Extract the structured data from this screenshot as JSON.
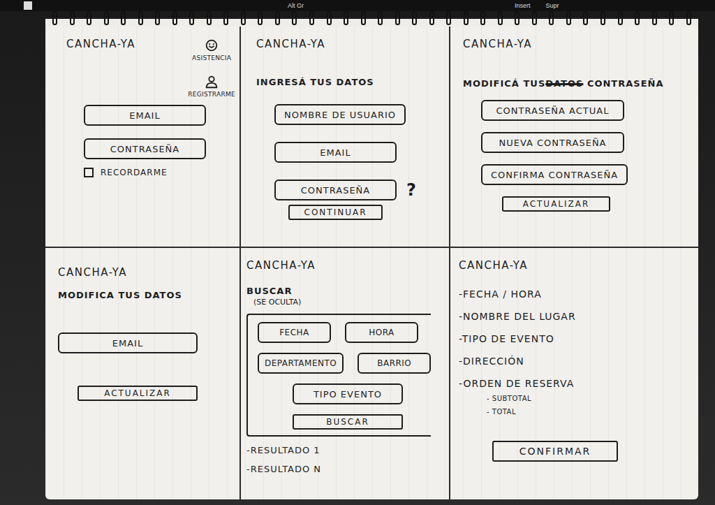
{
  "keyboard": [
    "Alt Gr",
    "Insert",
    "Supr"
  ],
  "screens": [
    {
      "title": "CANCHA-YA",
      "actions": [
        "ASISTENCIA",
        "REGISTRARME"
      ],
      "items": [
        {
          "kind": "field",
          "label": "EMAIL"
        },
        {
          "kind": "field",
          "label": "CONTRASEÑA"
        },
        {
          "kind": "checkbox",
          "label": "RECORDARME",
          "checked": false
        }
      ]
    },
    {
      "title": "CANCHA-YA",
      "items": [
        {
          "kind": "heading",
          "text": "INGRESÁ TUS DATOS"
        },
        {
          "kind": "field",
          "label": "NOMBRE DE USUARIO"
        },
        {
          "kind": "field",
          "label": "EMAIL"
        },
        {
          "kind": "field",
          "label": "CONTRASEÑA",
          "hint": "?"
        },
        {
          "kind": "button",
          "label": "CONTINUAR"
        }
      ]
    },
    {
      "title": "CANCHA-YA",
      "items": [
        {
          "kind": "heading",
          "text": "MODIFICÁ TUS",
          "struck": "DATOS",
          "after": "CONTRASEÑA"
        },
        {
          "kind": "field",
          "label": "CONTRASEÑA ACTUAL"
        },
        {
          "kind": "field",
          "label": "NUEVA CONTRASEÑA"
        },
        {
          "kind": "field",
          "label": "CONFIRMA CONTRASEÑA"
        },
        {
          "kind": "button",
          "label": "ACTUALIZAR"
        }
      ]
    },
    {
      "title": "CANCHA-YA",
      "items": [
        {
          "kind": "heading",
          "text": "MODIFICA TUS DATOS"
        },
        {
          "kind": "field",
          "label": "EMAIL"
        },
        {
          "kind": "button",
          "label": "ACTUALIZAR"
        }
      ]
    },
    {
      "title": "CANCHA-YA",
      "items": [
        {
          "kind": "heading",
          "text": "BUSCAR"
        },
        {
          "kind": "note",
          "text": "(SE OCULTA)"
        },
        {
          "kind": "group",
          "items": [
            {
              "kind": "row",
              "items": [
                {
                  "kind": "field",
                  "label": "FECHA"
                },
                {
                  "kind": "field",
                  "label": "HORA"
                }
              ]
            },
            {
              "kind": "row",
              "items": [
                {
                  "kind": "field",
                  "label": "DEPARTAMENTO"
                },
                {
                  "kind": "field",
                  "label": "BARRIO"
                }
              ]
            },
            {
              "kind": "field",
              "label": "TIPO EVENTO"
            },
            {
              "kind": "button",
              "label": "BUSCAR"
            }
          ]
        },
        {
          "kind": "list",
          "text": "-RESULTADO 1"
        },
        {
          "kind": "list",
          "text": "-RESULTADO N"
        }
      ]
    },
    {
      "title": "CANCHA-YA",
      "items": [
        {
          "kind": "list",
          "text": "-FECHA / HORA"
        },
        {
          "kind": "list",
          "text": "-NOMBRE DEL LUGAR"
        },
        {
          "kind": "list",
          "text": "-TIPO DE EVENTO"
        },
        {
          "kind": "list",
          "text": "-DIRECCIÓN"
        },
        {
          "kind": "list",
          "text": "-ORDEN DE RESERVA"
        },
        {
          "kind": "sub",
          "text": "- SUBTOTAL"
        },
        {
          "kind": "sub",
          "text": "- TOTAL"
        },
        {
          "kind": "button",
          "label": "CONFIRMAR"
        }
      ]
    }
  ]
}
